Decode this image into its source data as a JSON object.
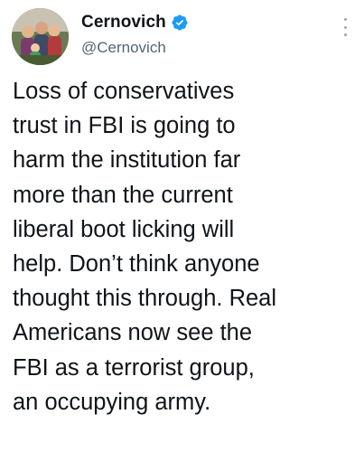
{
  "tweet": {
    "author": {
      "display_name": "Cernovich",
      "handle": "@Cernovich",
      "verified": true,
      "avatar_icon": "profile-photo"
    },
    "body_lines": [
      "Loss of conservatives",
      "trust in FBI is going to",
      "harm the institution far",
      "more than the current",
      "liberal boot licking will",
      "help. Don’t think anyone",
      "thought this through. Real",
      "Americans now see the",
      "FBI as a terrorist group,",
      "an occupying army."
    ],
    "menu_icon": "more-options-icon",
    "colors": {
      "verified": "#1d9bf0",
      "text": "#0f1419",
      "secondary": "#536471"
    }
  }
}
